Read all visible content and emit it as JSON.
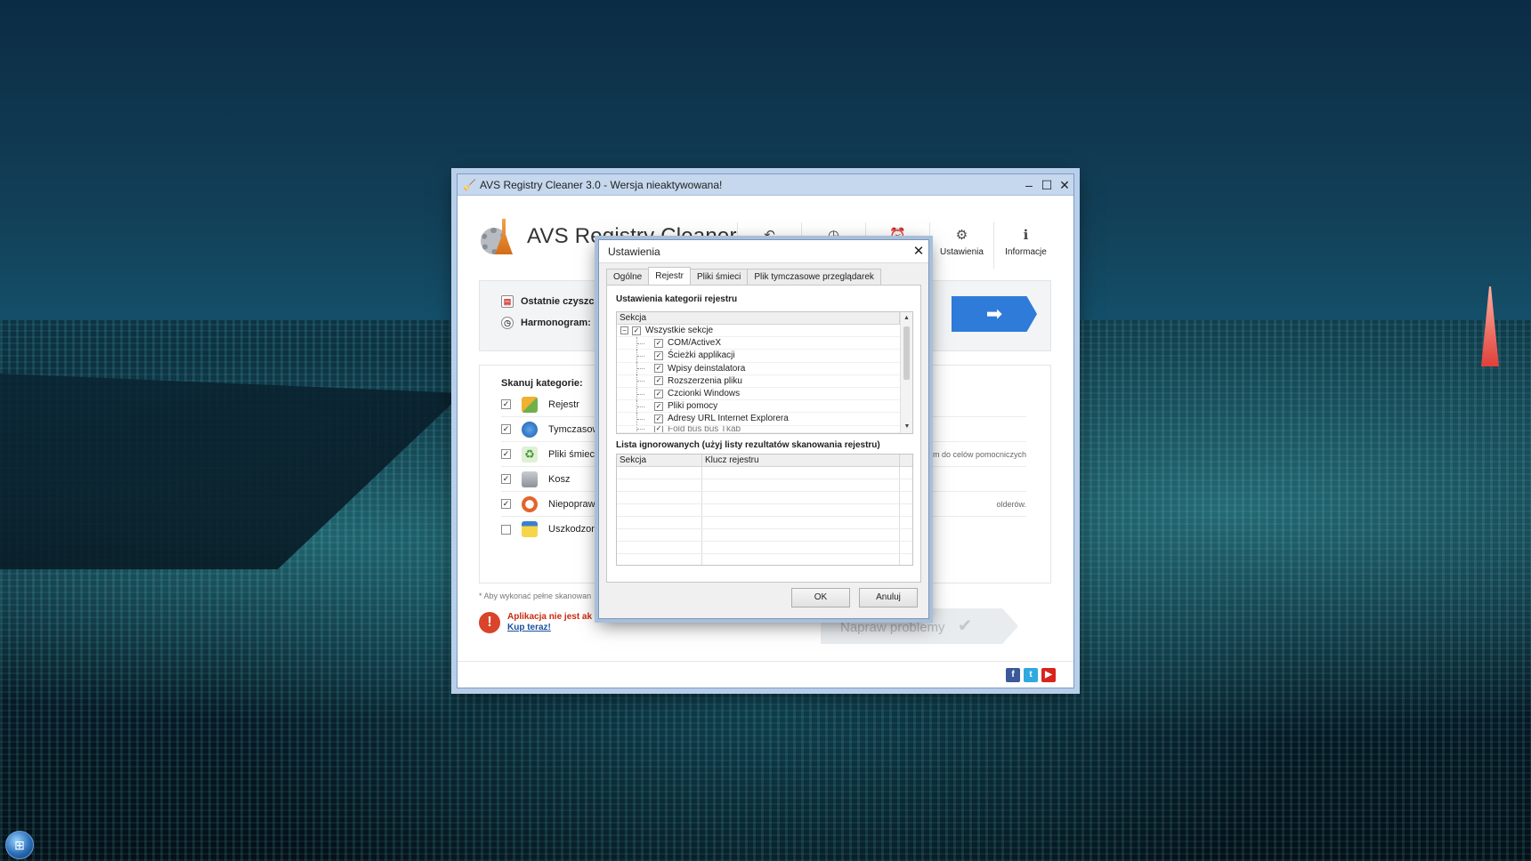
{
  "main_window": {
    "title": "AVS Registry Cleaner 3.0 - Wersja nieaktywowana!",
    "brand_name": "AVS Registry Cleaner",
    "toolbar": [
      {
        "label": "",
        "icon": "undo-icon"
      },
      {
        "label": "",
        "icon": "history-icon"
      },
      {
        "label": "",
        "icon": "alarm-clock-icon"
      },
      {
        "label": "Ustawienia",
        "icon": "gear-icon"
      },
      {
        "label": "Informacje",
        "icon": "info-icon"
      }
    ],
    "status": {
      "last_clean_label": "Ostatnie czyszcz",
      "schedule_label": "Harmonogram:"
    },
    "scan": {
      "title": "Skanuj kategorie:",
      "items": [
        {
          "label": "Rejestr",
          "checked": true,
          "desc": ""
        },
        {
          "label": "Tymczasow",
          "checked": true,
          "desc": ""
        },
        {
          "label": "Pliki śmieci",
          "checked": true,
          "desc": "ystem do celów pomocniczych"
        },
        {
          "label": "Kosz",
          "checked": true,
          "desc": ""
        },
        {
          "label": "Niepopraw",
          "checked": true,
          "desc": "olderów."
        },
        {
          "label": "Uszkodzon",
          "checked": false,
          "desc": ""
        }
      ]
    },
    "footnote": "* Aby wykonać pełne skanowan",
    "warning": {
      "text": "Aplikacja nie jest ak",
      "buy_link": "Kup teraz!"
    },
    "fix_button": "Napraw problemy",
    "social": [
      "f",
      "t",
      "▶"
    ]
  },
  "dialog": {
    "title": "Ustawienia",
    "tabs": [
      "Ogólne",
      "Rejestr",
      "Pliki śmieci",
      "Plik tymczasowe przeglądarek"
    ],
    "active_tab": "Rejestr",
    "registry_section_title": "Ustawienia kategorii rejestru",
    "tree_header": "Sekcja",
    "tree_root": "Wszystkie sekcje",
    "tree_items": [
      "COM/ActiveX",
      "Ścieżki applikacji",
      "Wpisy deinstalatora",
      "Rozszerzenia pliku",
      "Czcionki Windows",
      "Pliki pomocy",
      "Adresy URL Internet Explorera"
    ],
    "tree_partial_item": "Fold bus bus Tkab",
    "ignore_section_title": "Lista ignorowanych (użyj listy rezultatów skanowania rejestru)",
    "grid_columns": [
      "Sekcja",
      "Klucz rejestru"
    ],
    "ok_label": "OK",
    "cancel_label": "Anuluj"
  }
}
